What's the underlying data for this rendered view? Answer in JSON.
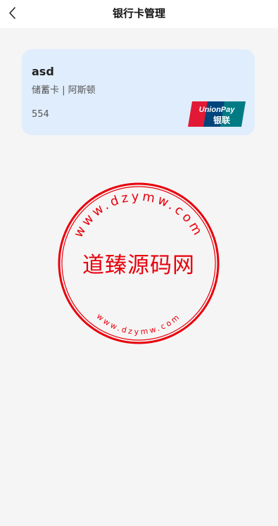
{
  "header": {
    "title": "银行卡管理"
  },
  "card": {
    "name": "asd",
    "type": "储蓄卡",
    "separator": " | ",
    "bank": "阿斯顿",
    "number": "554",
    "logo": {
      "top": "UnionPay",
      "bottom": "银联"
    }
  },
  "watermark": {
    "center_text": "道臻源码网",
    "ring_top": "www.dzymw.com",
    "ring_bottom": "www.dzymw.com",
    "color": "#e8000b"
  },
  "colors": {
    "page_bg": "#f5f5f5",
    "card_bg": "#e0edfc"
  }
}
